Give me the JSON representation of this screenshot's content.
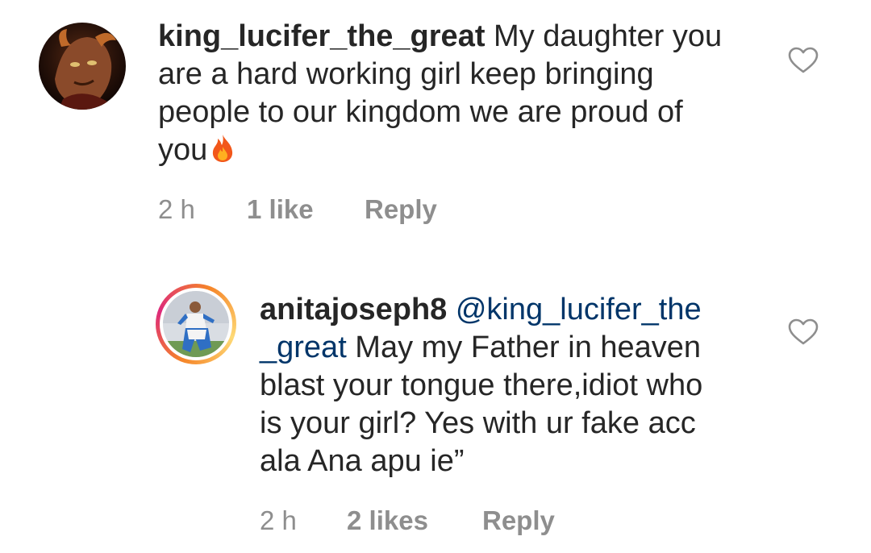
{
  "comments": [
    {
      "username": "king_lucifer_the_great",
      "text_line1": " My daughter you",
      "text_line2": "are  a hard working girl keep  bringing",
      "text_line3": "people to our kingdom we are proud of",
      "text_line4": "you",
      "emoji_icon": "fire-icon",
      "time": "2 h",
      "likes": "1 like",
      "reply": "Reply"
    },
    {
      "username": "anitajoseph8",
      "mention_part1": "@king_lucifer_the",
      "mention_part2": "_great",
      "text_line2_rest": " May my Father in heaven",
      "text_line3": "blast your tongue there,idiot who",
      "text_line4": "is your girl? Yes with ur fake acc",
      "text_line5": "ala Ana apu ie”",
      "time": "2 h",
      "likes": "2 likes",
      "reply": "Reply"
    }
  ],
  "colors": {
    "text": "#262626",
    "meta": "#8e8e8e",
    "mention": "#003569"
  }
}
